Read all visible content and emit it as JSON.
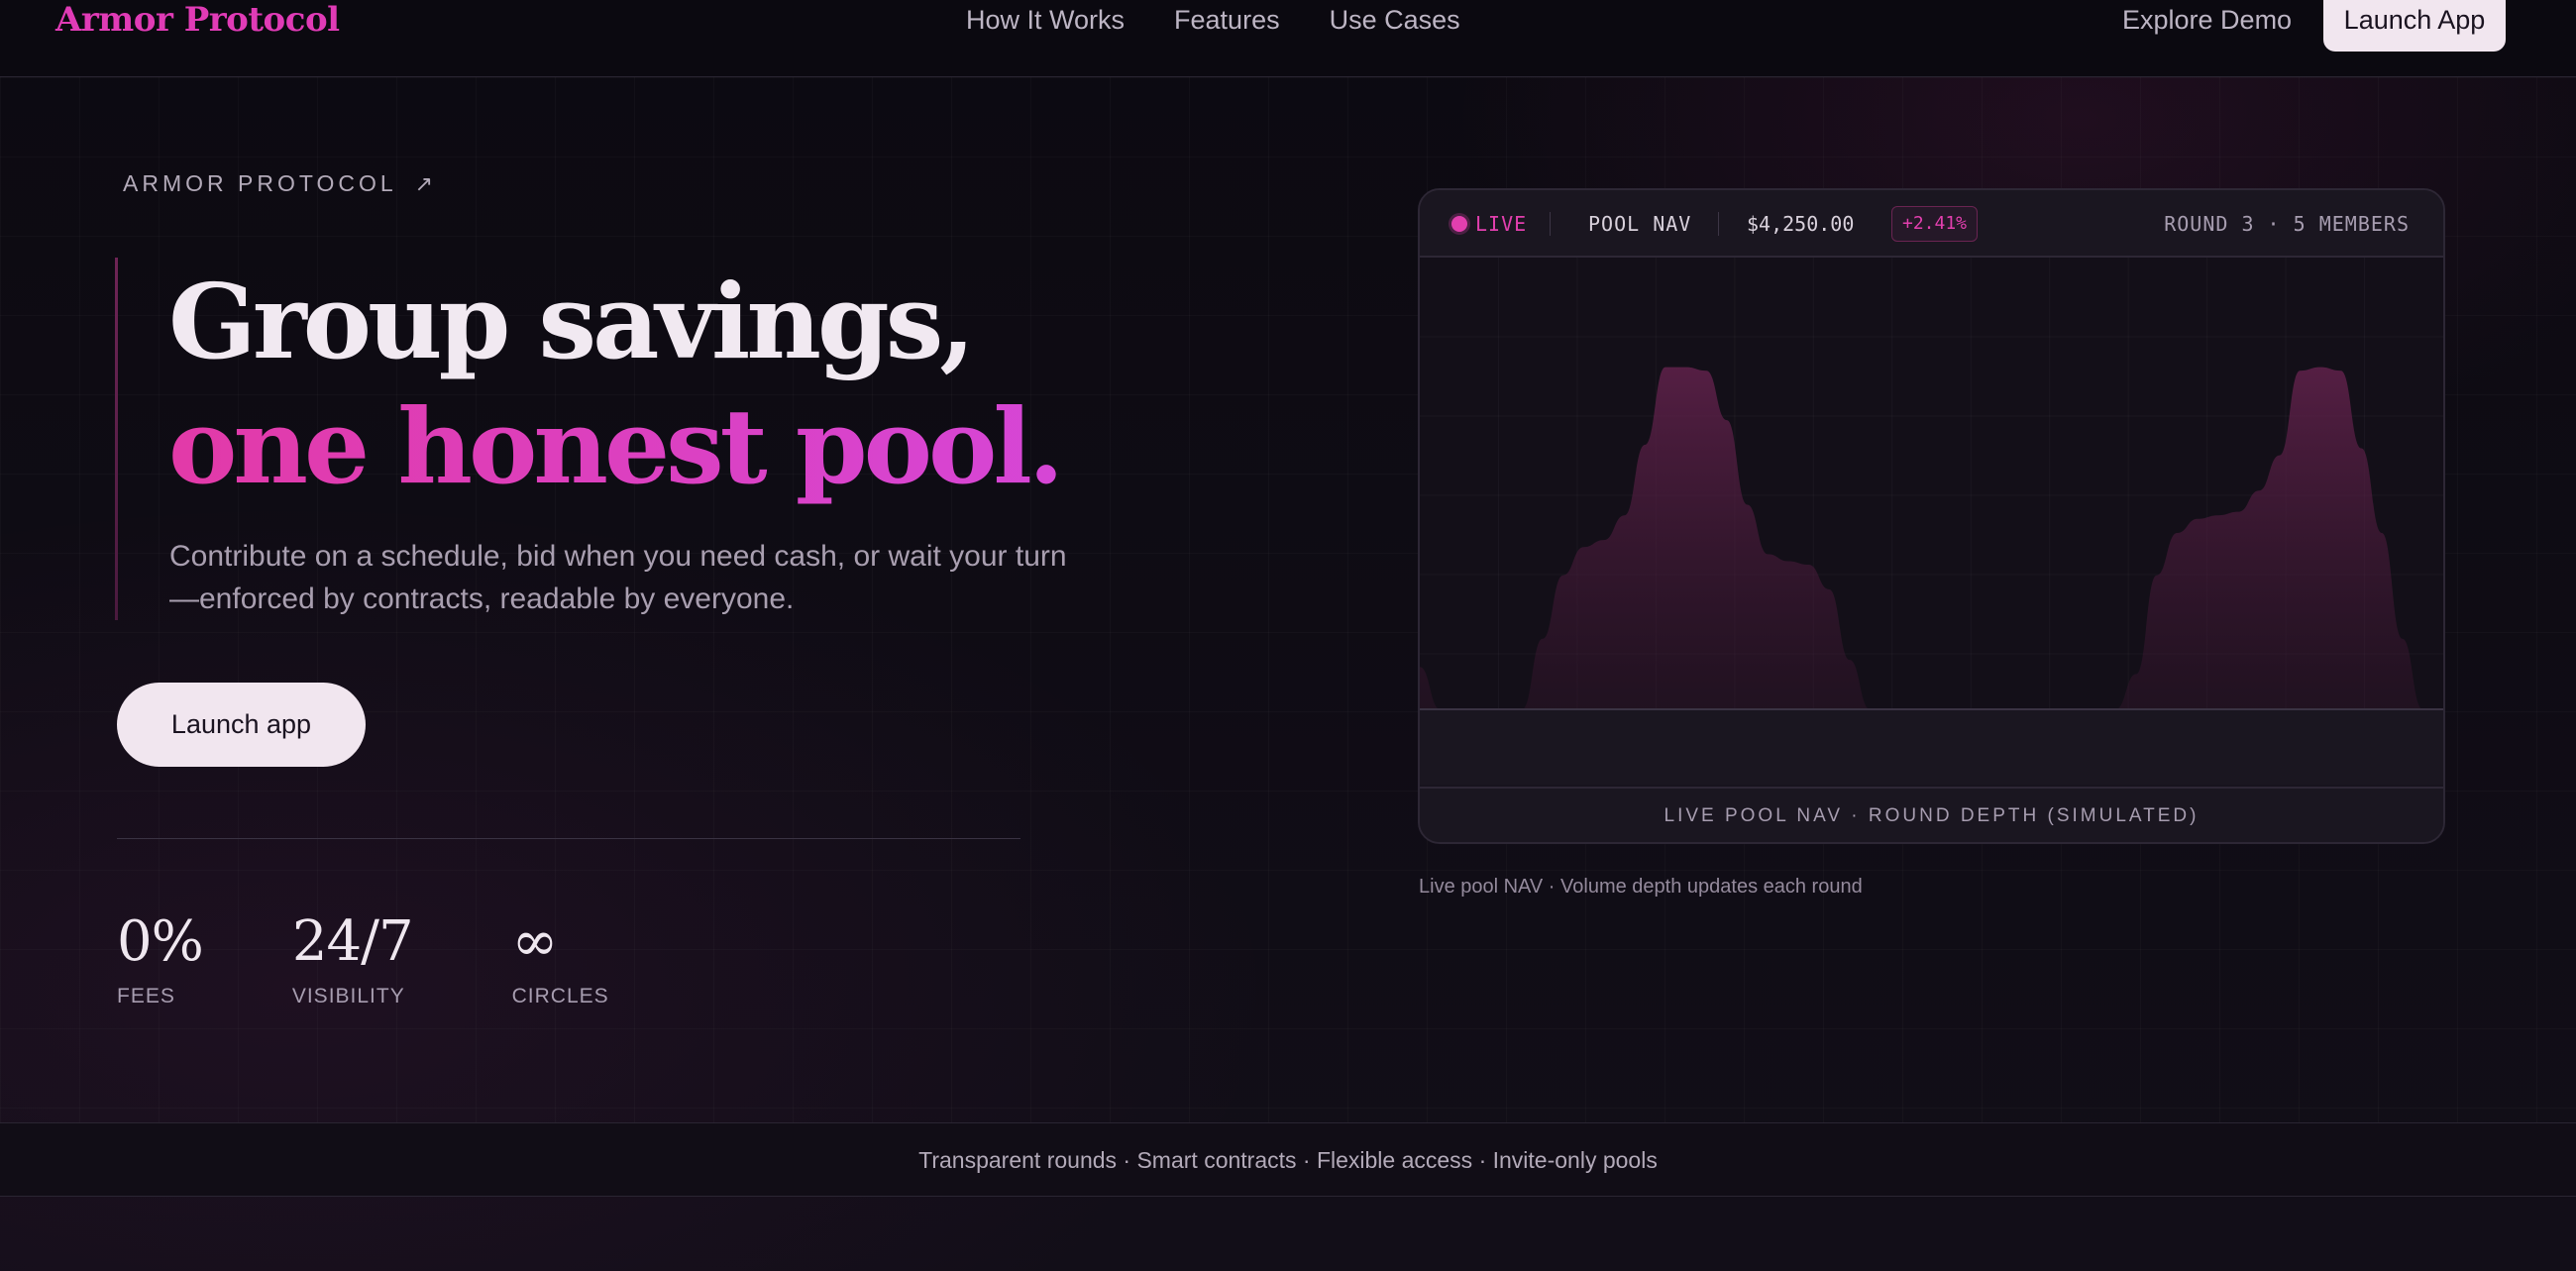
{
  "nav": {
    "brand": "Armor Protocol",
    "links": [
      "How It Works",
      "Features",
      "Use Cases"
    ],
    "explore": "Explore Demo",
    "launch": "Launch App"
  },
  "hero": {
    "eyebrow": "ARMOR PROTOCOL",
    "eyebrow_icon": "arrow-up-right-icon",
    "title_line1": "Group savings,",
    "title_line2": "one honest pool.",
    "lede": "Contribute on a schedule, bid when you need cash, or wait your turn —enforced by contracts, readable by everyone.",
    "cta": "Launch app",
    "stats": [
      {
        "value": "0%",
        "label": "FEES"
      },
      {
        "value": "24/7",
        "label": "VISIBILITY"
      },
      {
        "value": "∞",
        "label": "CIRCLES"
      }
    ]
  },
  "card": {
    "live": "LIVE",
    "pool_label": "POOL NAV",
    "pool_value": "$4,250.00",
    "change": "+2.41%",
    "round": "ROUND 3 · 5 MEMBERS",
    "footer": "LIVE POOL NAV · ROUND DEPTH (SIMULATED)",
    "caption": "Live pool NAV · Volume depth updates each round"
  },
  "chart_data": {
    "type": "area",
    "x": [
      0,
      2,
      4,
      6,
      8,
      10,
      12,
      14,
      16,
      18,
      20,
      22,
      24,
      26,
      28,
      30,
      32,
      34,
      36,
      38,
      40,
      42,
      44,
      46,
      48,
      50,
      52,
      54,
      56,
      58,
      60,
      62,
      64,
      66,
      68,
      70,
      72,
      74,
      76,
      78,
      80,
      82,
      84,
      86,
      88,
      90,
      92,
      94,
      96,
      98,
      100
    ],
    "series": [
      {
        "values": [
          0.12,
          0.0,
          0.0,
          0.0,
          0.0,
          0.0,
          0.2,
          0.38,
          0.46,
          0.48,
          0.55,
          0.75,
          0.97,
          0.97,
          0.96,
          0.82,
          0.58,
          0.44,
          0.42,
          0.41,
          0.34,
          0.14,
          0.0,
          0.0,
          0.0,
          0.0,
          0.0,
          0.0,
          0.0,
          0.0,
          0.0,
          0.0,
          0.0,
          0.0,
          0.0,
          0.1,
          0.38,
          0.5,
          0.54,
          0.55,
          0.56,
          0.62,
          0.72,
          0.96,
          0.97,
          0.96,
          0.74,
          0.5,
          0.2,
          0.0,
          0.0
        ]
      }
    ],
    "xlabel": "",
    "ylabel": "",
    "ylim": [
      0,
      1
    ],
    "grid": true,
    "color": "#6b2452"
  },
  "footer_strip": "Transparent rounds · Smart contracts · Flexible access · Invite-only pools",
  "colors": {
    "accent": "#e23fae",
    "bg": "#0d0b12",
    "button_bg": "#f1e6ef"
  }
}
